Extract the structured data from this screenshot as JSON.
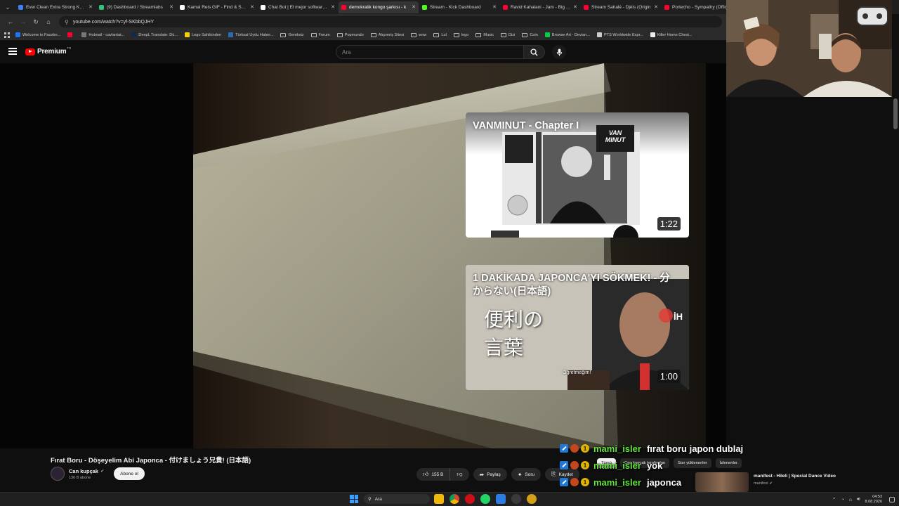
{
  "browser": {
    "tabs": [
      {
        "title": "Ever Clean Extra Strong Koku",
        "color": "#3b82f6",
        "active": false
      },
      {
        "title": "(9) Dashboard / Streamlabs",
        "color": "#31c27c",
        "active": false
      },
      {
        "title": "Kamal Reis GIF - Find & Share",
        "color": "#ffffff",
        "active": false
      },
      {
        "title": "Chat Bot | El mejor software p",
        "color": "#ffffff",
        "active": false
      },
      {
        "title": "demokratik kongo şarkısı - k",
        "color": "#ff0033",
        "active": true
      },
      {
        "title": "Stream - Kick Dashboard",
        "color": "#53fc18",
        "active": false
      },
      {
        "title": "Ravid Kahalani - Jam - Big Ch",
        "color": "#ff0033",
        "active": false
      },
      {
        "title": "Stream Sahalé - Djéis (Origin",
        "color": "#ff0033",
        "active": false
      },
      {
        "title": "Portecho - Sympathy (Officia",
        "color": "#ff0033",
        "active": false
      }
    ],
    "url": "youtube.com/watch?v=yf-SKbbQJHY",
    "bookmarks": [
      {
        "label": "Welcome to Facebo...",
        "type": "icon",
        "color": "#1877f2"
      },
      {
        "label": "",
        "type": "icon",
        "color": "#ff0033"
      },
      {
        "label": "Hotmail - cavlantat...",
        "type": "icon",
        "color": "#777777"
      },
      {
        "label": "DeepL Translate: Dü...",
        "type": "icon",
        "color": "#0f2b46"
      },
      {
        "label": "Lego Sahibinden",
        "type": "icon",
        "color": "#f5d000"
      },
      {
        "label": "Türksat Uydu Haber...",
        "type": "icon",
        "color": "#2b6cb0"
      },
      {
        "label": "Gereksiz",
        "type": "folder"
      },
      {
        "label": "Forum",
        "type": "folder"
      },
      {
        "label": "Popmundo",
        "type": "folder"
      },
      {
        "label": "Alışveriş Sitesi",
        "type": "folder"
      },
      {
        "label": "wow",
        "type": "folder"
      },
      {
        "label": "Lol",
        "type": "folder"
      },
      {
        "label": "lego",
        "type": "folder"
      },
      {
        "label": "Music",
        "type": "folder"
      },
      {
        "label": "Dizi",
        "type": "folder"
      },
      {
        "label": "Coin",
        "type": "folder"
      },
      {
        "label": "Browse Art - Devian...",
        "type": "icon",
        "color": "#05cc47"
      },
      {
        "label": "PTS Worldwide Expr...",
        "type": "icon",
        "color": "#cccccc"
      },
      {
        "label": "Killer Home Chest...",
        "type": "icon",
        "color": "#eeeeee"
      }
    ]
  },
  "youtube": {
    "brand": "Premium",
    "country_code": "TR",
    "search_placeholder": "Ara",
    "cards": [
      {
        "title": "VANMINUT - Chapter I",
        "duration": "1:22",
        "poster_text": "VAN MINUT"
      },
      {
        "title": "1 DAKİKADA JAPONCA'YI SÖKMEK! - 分からない(日本語)",
        "duration": "1:00",
        "line1": "便利の",
        "line2": "言葉",
        "caption": "Öğretmeğim!",
        "logo": "İH"
      }
    ],
    "video_title": "Fırat Boru - Döşeyelim Abi Japonca - 付けましょう兄貴! (日本語)",
    "channel": {
      "name": "Can kupçak",
      "subs": "136 B abone",
      "subscribe_label": "Abone ol"
    },
    "actions": {
      "likes": "155 B",
      "share": "Paylaş",
      "ask": "Soru",
      "save": "Kaydet"
    },
    "chips": [
      "Tümü",
      "Can kupçak tarafından",
      "Son yüklenenler",
      "İzlenenler"
    ],
    "rec": {
      "title": "manifest - Hileli | Special Dance Video",
      "channel": "manifest"
    }
  },
  "chat": [
    {
      "user": "mami_isler",
      "text": "fırat boru japon dublaj",
      "level": "1"
    },
    {
      "user": "mami_isler",
      "text": "yok",
      "level": "1"
    },
    {
      "user": "mami_isler",
      "text": "japonca",
      "level": "1"
    }
  ],
  "taskbar": {
    "search_placeholder": "Ara",
    "time": "04:53",
    "date": "8.08.2026"
  }
}
